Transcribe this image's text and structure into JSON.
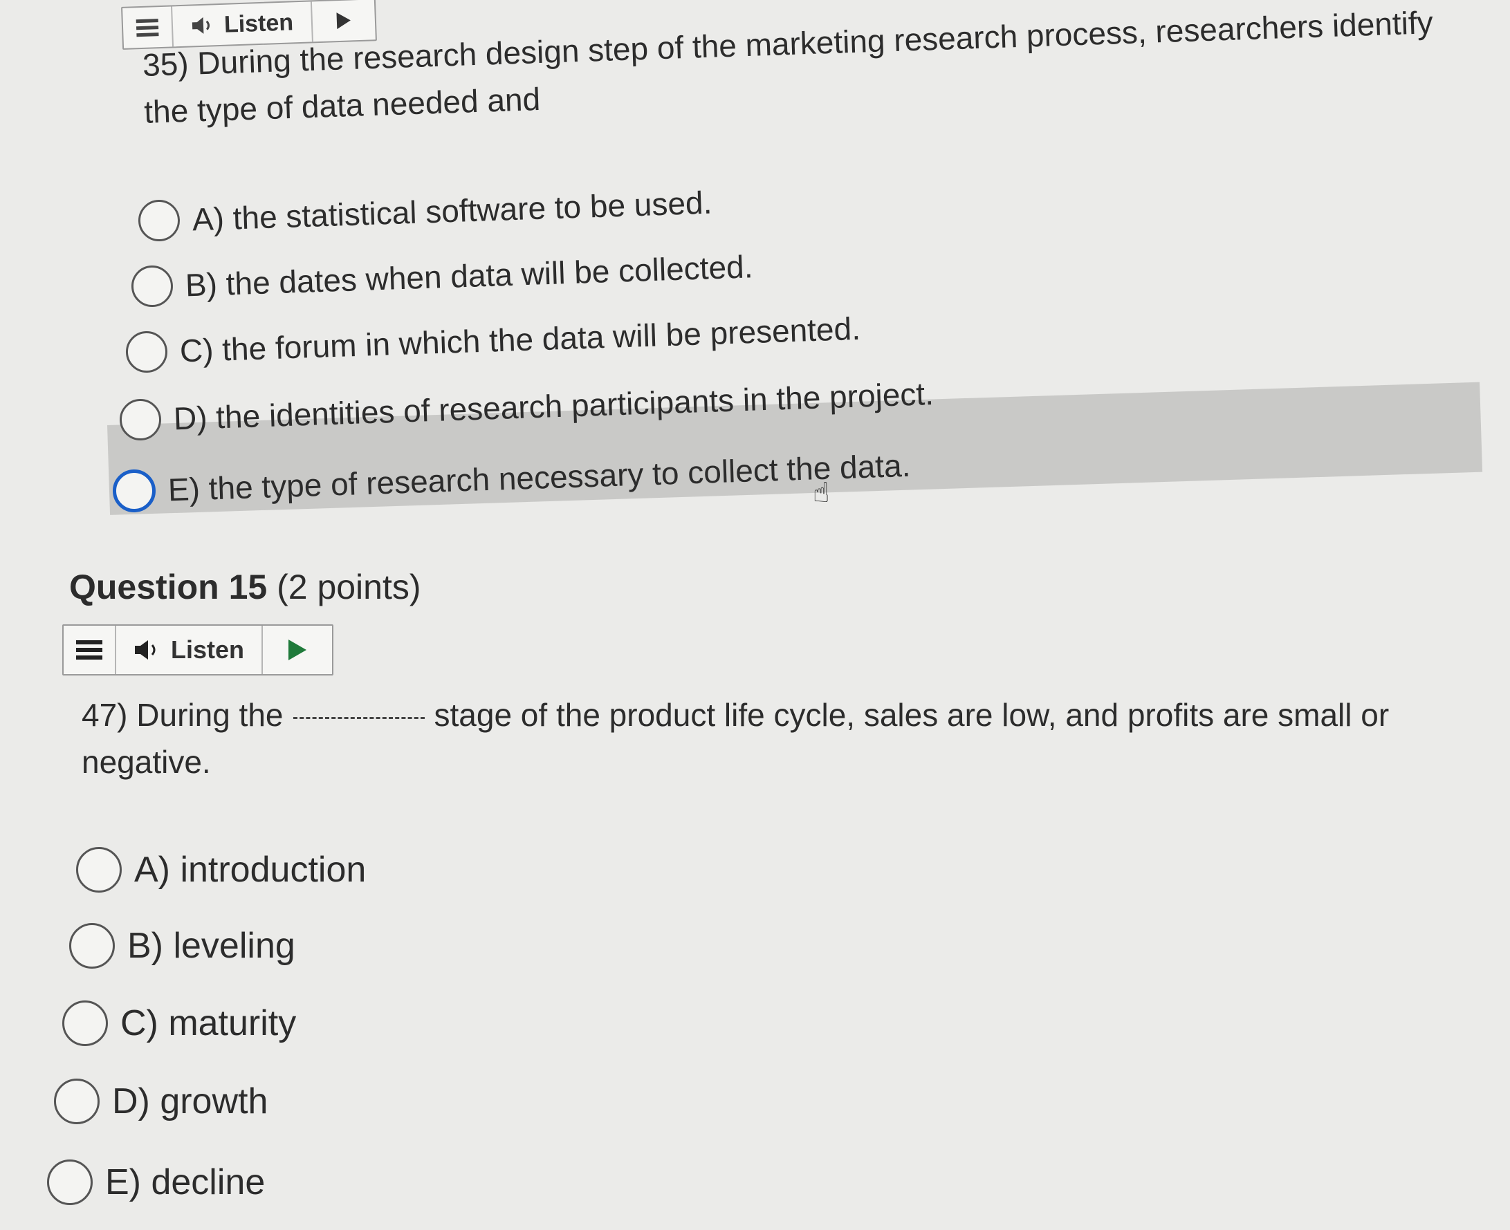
{
  "toolbar": {
    "listen_label": "Listen"
  },
  "question1": {
    "text": "35) During the research design step of the marketing research process, researchers identify the type of data needed and",
    "options": [
      "A) the statistical software to be used.",
      "B) the dates when data will be collected.",
      "C) the forum in which the data will be presented.",
      "D) the identities of research participants in the project.",
      "E) the type of research necessary to collect the data."
    ]
  },
  "question2": {
    "heading_label": "Question 15",
    "heading_points": "(2 points)",
    "text_before_blank": "47) During the",
    "text_after_blank": "stage of the product life cycle, sales are low, and profits are small or negative.",
    "options": [
      "A) introduction",
      "B) leveling",
      "C) maturity",
      "D) growth",
      "E) decline"
    ]
  },
  "colors": {
    "page_background": "#ebebe9",
    "hover_highlight": "#c9c9c7",
    "focus_ring": "#1a5fc8",
    "play_button": "#1f7a3a"
  }
}
